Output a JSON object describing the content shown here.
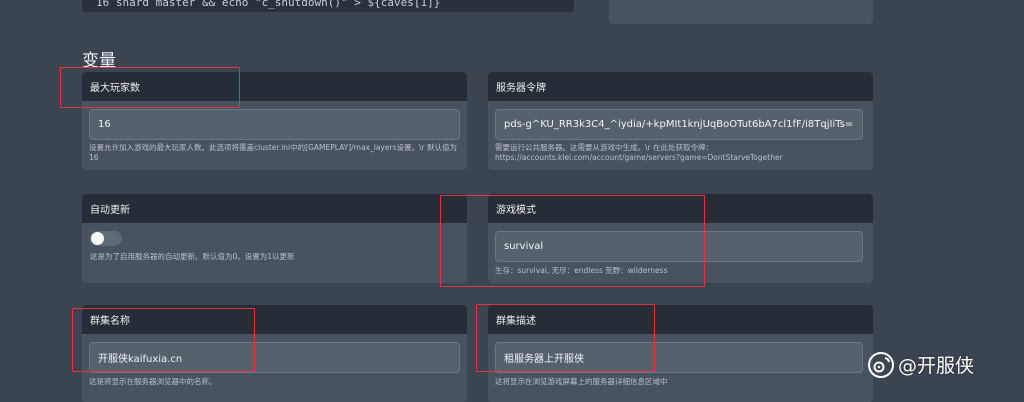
{
  "top_code": {
    "text": "16  shard master && echo \"c_shutdown()\" > ${caves[1]}"
  },
  "section": {
    "title": "变量"
  },
  "cards": {
    "max_players": {
      "title": "最大玩家数",
      "value": "16",
      "help": "设置允许加入游戏的最大玩家人数。此选项将覆盖cluster.ini中的[GAMEPLAY]/max_layers设置。\\r 默认值为16"
    },
    "server_token": {
      "title": "服务器令牌",
      "value": "pds-g^KU_RR3k3C4_^iydia/+kpMIt1knjUqBoOTut6bA7cl1fF/i8TqjIiTs=",
      "help_line1": "需要运行公共服务器。这需要从游戏中生成。\\r 在此处获取令牌：",
      "help_line2": "https://accounts.klei.com/account/game/servers?game=DontStarveTogether"
    },
    "auto_update": {
      "title": "自动更新",
      "help": "这是为了启用服务器的自动更新。默认值为0。设置为1以更新"
    },
    "game_mode": {
      "title": "游戏模式",
      "value": "survival",
      "help": "生存：survival, 无尽：endless 荒野：wilderness"
    },
    "cluster_name": {
      "title": "群集名称",
      "value": "开服侠kaifuxia.cn",
      "help": "这是将显示在服务器浏览器中的名称。"
    },
    "cluster_desc": {
      "title": "群集描述",
      "value": "租服务器上开服侠",
      "help": "这将显示在浏览游戏屏幕上的服务器详细信息区域中"
    }
  },
  "watermark": {
    "text": "@开服侠"
  },
  "colors": {
    "highlight": "#e0343c",
    "background": "#3b4451",
    "card": "#485260",
    "header": "#262d36"
  }
}
